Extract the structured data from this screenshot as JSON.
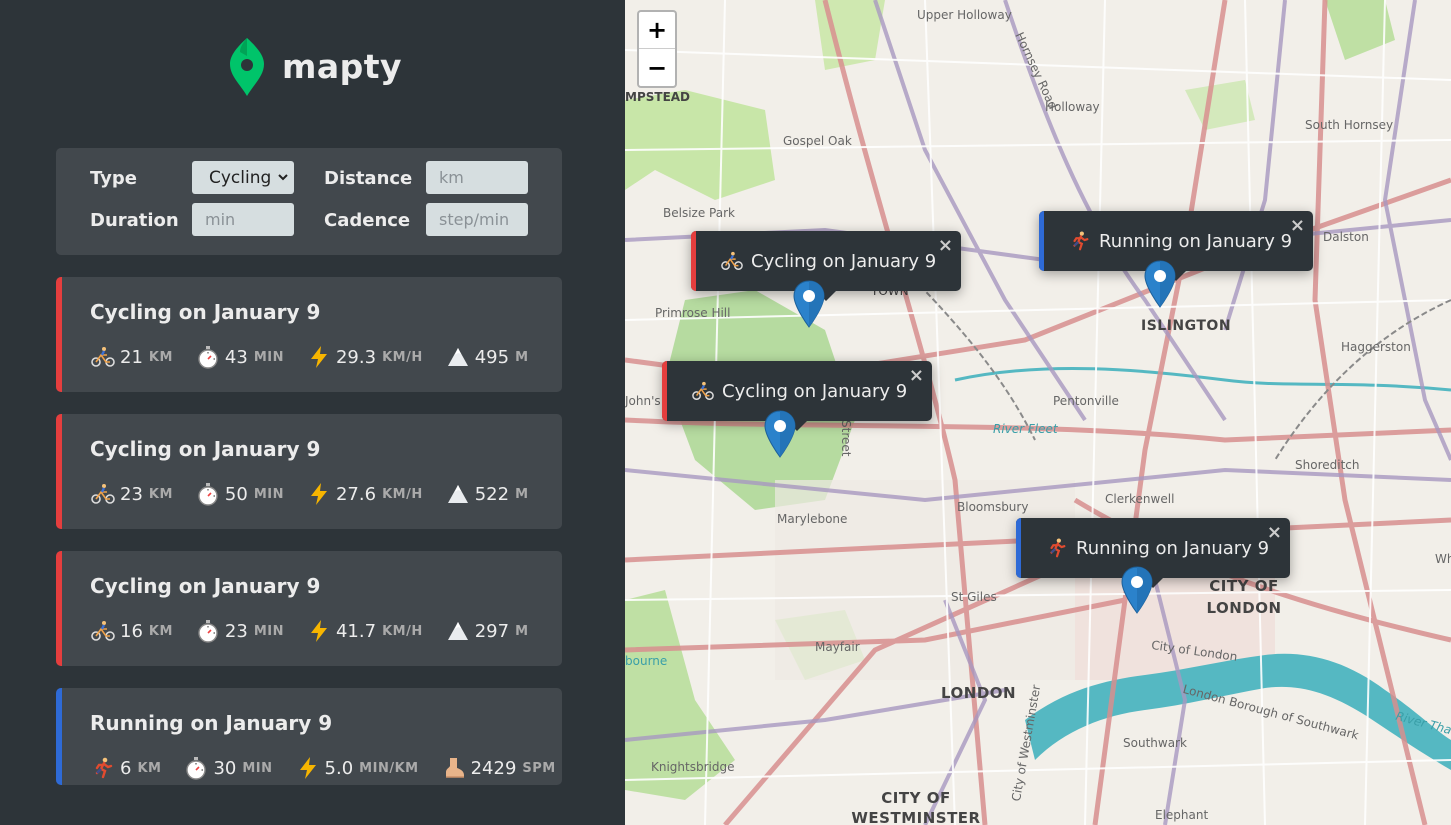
{
  "app": {
    "name": "mapty"
  },
  "form": {
    "type_label": "Type",
    "type_value": "Cycling",
    "distance_label": "Distance",
    "distance_placeholder": "km",
    "duration_label": "Duration",
    "duration_placeholder": "min",
    "cadence_label": "Cadence",
    "cadence_placeholder": "step/min"
  },
  "colors": {
    "cycling": "#e53e3e",
    "running": "#2e6ad6",
    "marker": "#2b82cb",
    "brand": "#00c46a"
  },
  "workouts": [
    {
      "title": "Cycling on January 9",
      "kind": "cycling",
      "distance": "21",
      "distance_unit": "KM",
      "duration": "43",
      "duration_unit": "MIN",
      "speed": "29.3",
      "speed_unit": "KM/H",
      "extra": "495",
      "extra_unit": "M",
      "icons": [
        "cyclist-icon",
        "stopwatch-icon",
        "lightning-icon",
        "mountain-icon"
      ]
    },
    {
      "title": "Cycling on January 9",
      "kind": "cycling",
      "distance": "23",
      "distance_unit": "KM",
      "duration": "50",
      "duration_unit": "MIN",
      "speed": "27.6",
      "speed_unit": "KM/H",
      "extra": "522",
      "extra_unit": "M",
      "icons": [
        "cyclist-icon",
        "stopwatch-icon",
        "lightning-icon",
        "mountain-icon"
      ]
    },
    {
      "title": "Cycling on January 9",
      "kind": "cycling",
      "distance": "16",
      "distance_unit": "KM",
      "duration": "23",
      "duration_unit": "MIN",
      "speed": "41.7",
      "speed_unit": "KM/H",
      "extra": "297",
      "extra_unit": "M",
      "icons": [
        "cyclist-icon",
        "stopwatch-icon",
        "lightning-icon",
        "mountain-icon"
      ]
    },
    {
      "title": "Running on January 9",
      "kind": "running",
      "distance": "6",
      "distance_unit": "KM",
      "duration": "30",
      "duration_unit": "MIN",
      "speed": "5.0",
      "speed_unit": "MIN/KM",
      "extra": "2429",
      "extra_unit": "SPM",
      "icons": [
        "runner-icon",
        "stopwatch-icon",
        "lightning-icon",
        "foot-icon"
      ]
    }
  ],
  "map": {
    "zoom_in": "+",
    "zoom_out": "−",
    "popups": [
      {
        "text": "Cycling on January 9",
        "kind": "cycling",
        "close": "×"
      },
      {
        "text": "Running on January 9",
        "kind": "running",
        "close": "×"
      },
      {
        "text": "Cycling on January 9",
        "kind": "cycling",
        "close": "×"
      },
      {
        "text": "Running on January 9",
        "kind": "running",
        "close": "×"
      }
    ],
    "labels": {
      "upper_holloway": "Upper Holloway",
      "hornsey_road": "Hornsey Road",
      "hampstead": "MPSTEAD",
      "holloway": "Holloway",
      "gospel_oak": "Gospel Oak",
      "south_hornsey": "South Hornsey",
      "belsize_park": "Belsize Park",
      "dalston": "Dalston",
      "primrose_hill": "Primrose Hill",
      "town": "TOWN",
      "islington": "ISLINGTON",
      "haggerston": "Haggerston",
      "st_johns_wood": "John's Wood",
      "pentonville": "Pentonville",
      "river_fleet": "River Fleet",
      "shoreditch": "Shoreditch",
      "bloomsbury": "Bloomsbury",
      "clerkenwell": "Clerkenwell",
      "marylebone": "Marylebone",
      "st_giles": "St Giles",
      "city_of_london": "CITY OF LONDON",
      "city_of_london_small": "City of London",
      "whitechapel": "White",
      "mayfair": "Mayfair",
      "london": "LONDON",
      "city_of_westminster_road": "City of Westminster",
      "borough_southwark": "London Borough of Southwark",
      "southwark": "Southwark",
      "knightsbridge": "Knightsbridge",
      "city_of_westminster": "CITY OF WESTMINSTER",
      "elephant": "Elephant",
      "river_thames": "River Tha",
      "bourne": "bourne",
      "street": "Street"
    }
  }
}
